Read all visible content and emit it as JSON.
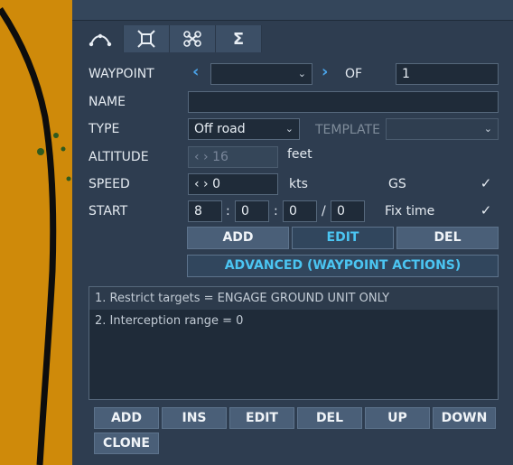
{
  "tabs": [
    {
      "icon": "waypoint-path-icon"
    },
    {
      "icon": "target-box-icon"
    },
    {
      "icon": "drone-icon"
    },
    {
      "icon": "sigma-icon"
    }
  ],
  "form": {
    "waypoint_label": "WAYPOINT",
    "of_label": "OF",
    "of_value": "1",
    "name_label": "NAME",
    "type_label": "TYPE",
    "type_value": "Off road",
    "template_label": "TEMPLATE",
    "altitude_label": "ALTITUDE",
    "altitude_value": "16",
    "altitude_unit": "feet",
    "speed_label": "SPEED",
    "speed_value": "0",
    "speed_unit": "kts",
    "gs_label": "GS",
    "start_label": "START",
    "start_h": "8",
    "start_m": "0",
    "start_s": "0",
    "start_f": "0",
    "fixtime_label": "Fix time"
  },
  "buttons": {
    "add": "ADD",
    "edit": "EDIT",
    "del": "DEL",
    "advanced": "ADVANCED (WAYPOINT ACTIONS)"
  },
  "actions": [
    "1. Restrict targets = ENGAGE GROUND UNIT ONLY",
    "2. Interception range = 0"
  ],
  "list_buttons": {
    "add": "ADD",
    "ins": "INS",
    "edit": "EDIT",
    "del": "DEL",
    "up": "UP",
    "down": "DOWN",
    "clone": "CLONE"
  },
  "colors": {
    "map": "#cf8a0a",
    "panel": "#2e3d50",
    "accent": "#4bc5f2"
  }
}
